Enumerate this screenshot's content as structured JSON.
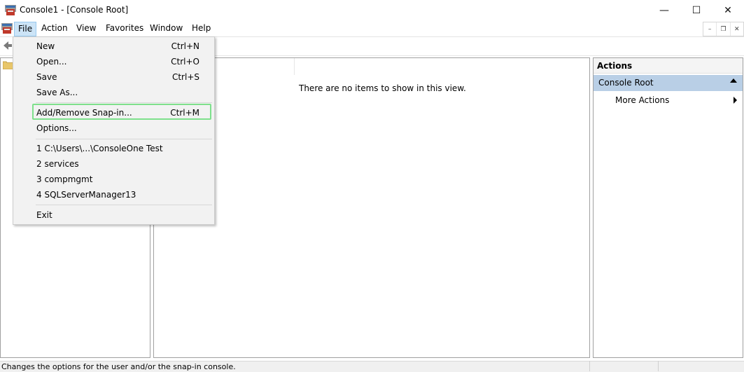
{
  "window": {
    "title": "Console1 - [Console Root]",
    "controls": {
      "minimize": "—",
      "maximize": "☐",
      "close": "✕"
    }
  },
  "menubar": {
    "items": [
      "File",
      "Action",
      "View",
      "Favorites",
      "Window",
      "Help"
    ],
    "mdi": {
      "minimize": "–",
      "restore": "❐",
      "close": "✕"
    }
  },
  "center": {
    "empty_message": "There are no items to show in this view."
  },
  "actions": {
    "header": "Actions",
    "section": "Console Root",
    "more_actions": "More Actions"
  },
  "file_menu": {
    "items": [
      {
        "label": "New",
        "shortcut": "Ctrl+N"
      },
      {
        "label": "Open...",
        "shortcut": "Ctrl+O"
      },
      {
        "label": "Save",
        "shortcut": "Ctrl+S"
      },
      {
        "label": "Save As...",
        "shortcut": ""
      },
      {
        "label": "Add/Remove Snap-in...",
        "shortcut": "Ctrl+M"
      },
      {
        "label": "Options...",
        "shortcut": ""
      },
      {
        "label": "1 C:\\Users\\...\\ConsoleOne Test",
        "shortcut": ""
      },
      {
        "label": "2 services",
        "shortcut": ""
      },
      {
        "label": "3 compmgmt",
        "shortcut": ""
      },
      {
        "label": "4 SQLServerManager13",
        "shortcut": ""
      },
      {
        "label": "Exit",
        "shortcut": ""
      }
    ]
  },
  "status": {
    "text": "Changes the options for the user and/or the snap-in console."
  },
  "colors": {
    "highlight_border": "#7ee08c",
    "selected_section": "#b9cfe6",
    "menu_active": "#cce4f7"
  }
}
